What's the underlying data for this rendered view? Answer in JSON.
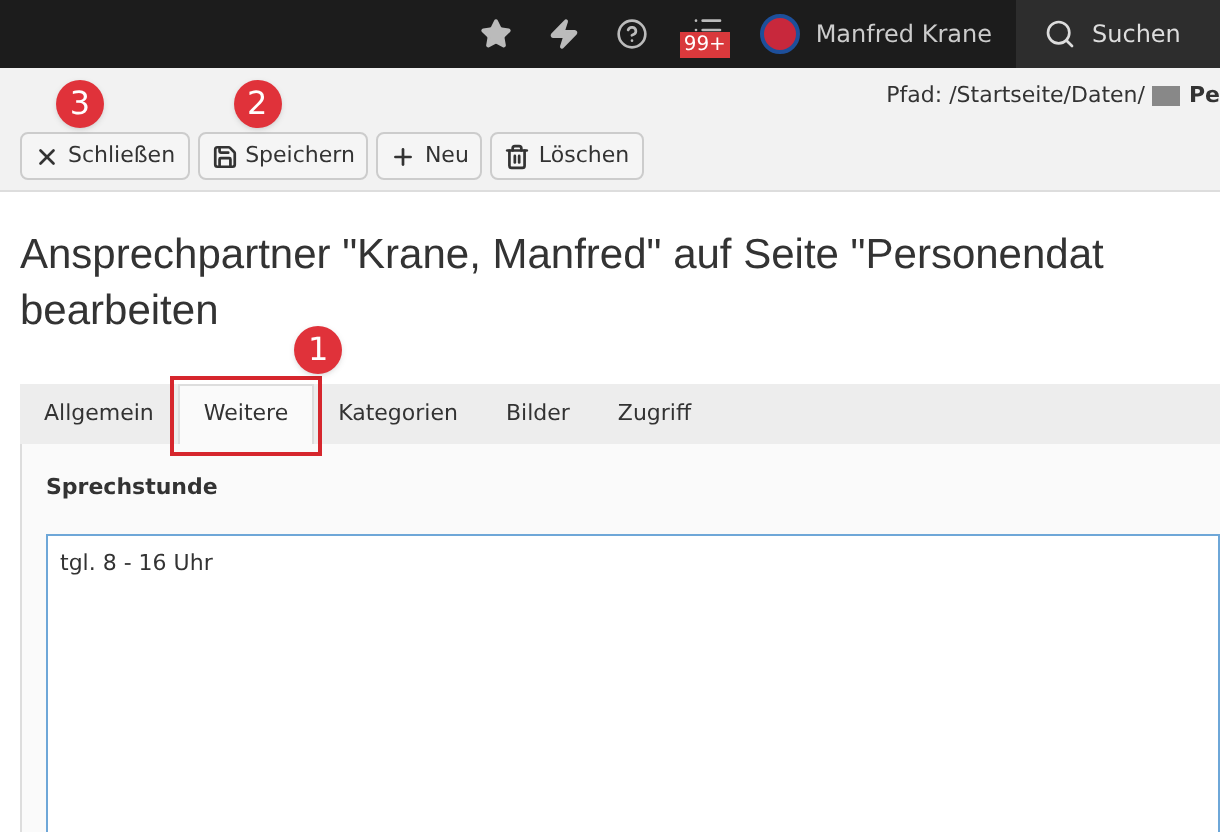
{
  "topbar": {
    "notification_badge": "99+",
    "user_name": "Manfred Krane",
    "search_label": "Suchen"
  },
  "path": {
    "label": "Pfad: /Startseite/Daten/",
    "current": "Pe"
  },
  "toolbar": [
    {
      "kind": "close",
      "label": "Schließen",
      "callout": "3"
    },
    {
      "kind": "save",
      "label": "Speichern",
      "callout": "2"
    },
    {
      "kind": "new",
      "label": "Neu"
    },
    {
      "kind": "delete",
      "label": "Löschen"
    }
  ],
  "title_lines": [
    "Ansprechpartner \"Krane, Manfred\" auf Seite \"Personendat",
    "bearbeiten"
  ],
  "tabs": [
    {
      "label": "Allgemein",
      "selected": false
    },
    {
      "label": "Weitere",
      "selected": true,
      "callout": "1"
    },
    {
      "label": "Kategorien",
      "selected": false
    },
    {
      "label": "Bilder",
      "selected": false
    },
    {
      "label": "Zugriff",
      "selected": false
    }
  ],
  "field": {
    "label": "Sprechstunde",
    "value": "tgl. 8 - 16 Uhr"
  }
}
